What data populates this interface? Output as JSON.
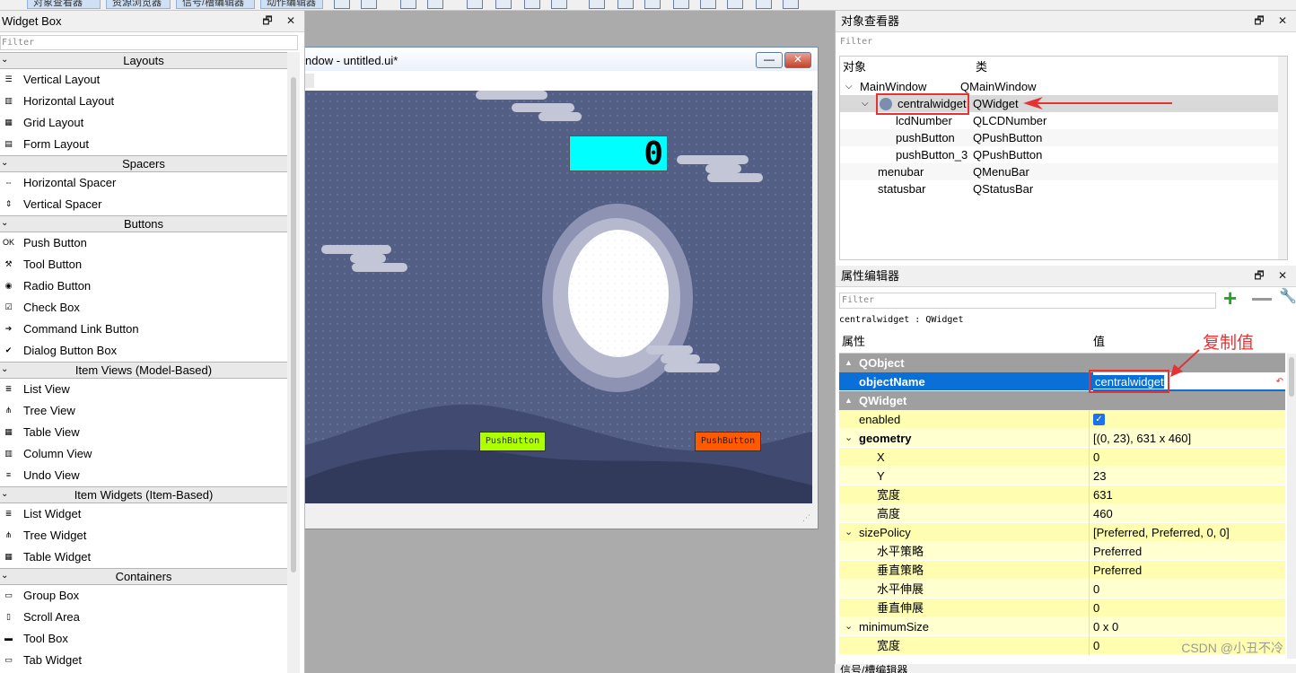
{
  "toolbar": {
    "tabs": [
      "对象查看器",
      "资源浏览器",
      "信号/槽编辑器",
      "动作编辑器"
    ]
  },
  "widget_box": {
    "title": "Widget Box",
    "float_btn": "🗗",
    "close_btn": "✕",
    "filter_placeholder": "Filter",
    "categories": [
      {
        "name": "Layouts",
        "items": [
          "Vertical Layout",
          "Horizontal Layout",
          "Grid Layout",
          "Form Layout"
        ]
      },
      {
        "name": "Spacers",
        "items": [
          "Horizontal Spacer",
          "Vertical Spacer"
        ]
      },
      {
        "name": "Buttons",
        "items": [
          "Push Button",
          "Tool Button",
          "Radio Button",
          "Check Box",
          "Command Link Button",
          "Dialog Button Box"
        ]
      },
      {
        "name": "Item Views (Model-Based)",
        "items": [
          "List View",
          "Tree View",
          "Table View",
          "Column View",
          "Undo View"
        ]
      },
      {
        "name": "Item Widgets (Item-Based)",
        "items": [
          "List Widget",
          "Tree Widget",
          "Table Widget"
        ]
      },
      {
        "name": "Containers",
        "items": [
          "Group Box",
          "Scroll Area",
          "Tool Box",
          "Tab Widget"
        ]
      }
    ]
  },
  "form_window": {
    "title": "ndow - untitled.ui*",
    "minimize": "—",
    "close": "✕",
    "lcd_value": "0",
    "push_button_1": "PushButton",
    "push_button_2": "PushButton"
  },
  "object_inspector": {
    "title": "对象查看器",
    "filter_placeholder": "Filter",
    "col_object": "对象",
    "col_class": "类",
    "rows": [
      {
        "object": "MainWindow",
        "class": "QMainWindow"
      },
      {
        "object": "centralwidget",
        "class": "QWidget"
      },
      {
        "object": "lcdNumber",
        "class": "QLCDNumber"
      },
      {
        "object": "pushButton",
        "class": "QPushButton"
      },
      {
        "object": "pushButton_3",
        "class": "QPushButton"
      },
      {
        "object": "menubar",
        "class": "QMenuBar"
      },
      {
        "object": "statusbar",
        "class": "QStatusBar"
      }
    ]
  },
  "property_editor": {
    "title": "属性编辑器",
    "filter_placeholder": "Filter",
    "caption": "centralwidget : QWidget",
    "col_property": "属性",
    "col_value": "值",
    "rows": [
      {
        "type": "group",
        "key": "QObject"
      },
      {
        "type": "prop",
        "key": "objectName",
        "value": "centralwidget",
        "selected": true
      },
      {
        "type": "group",
        "key": "QWidget"
      },
      {
        "type": "prop",
        "key": "enabled",
        "value": "✓"
      },
      {
        "type": "prop",
        "key": "geometry",
        "value": "[(0, 23), 631 x 460]",
        "bold": true
      },
      {
        "type": "sub",
        "key": "X",
        "value": "0"
      },
      {
        "type": "sub",
        "key": "Y",
        "value": "23"
      },
      {
        "type": "sub",
        "key": "宽度",
        "value": "631"
      },
      {
        "type": "sub",
        "key": "高度",
        "value": "460"
      },
      {
        "type": "prop",
        "key": "sizePolicy",
        "value": "[Preferred, Preferred, 0, 0]"
      },
      {
        "type": "sub",
        "key": "水平策略",
        "value": "Preferred"
      },
      {
        "type": "sub",
        "key": "垂直策略",
        "value": "Preferred"
      },
      {
        "type": "sub",
        "key": "水平伸展",
        "value": "0"
      },
      {
        "type": "sub",
        "key": "垂直伸展",
        "value": "0"
      },
      {
        "type": "prop",
        "key": "minimumSize",
        "value": "0 x 0"
      },
      {
        "type": "sub",
        "key": "宽度",
        "value": "0"
      }
    ]
  },
  "annotation": {
    "copy_label": "复制值"
  },
  "bottom_dock_title": "信号/槽编辑器",
  "watermark": "CSDN @小丑不冷",
  "colors": {
    "accent": "#e53333",
    "lcd": "#00ffff",
    "button_green": "#aeff00",
    "button_orange": "#ff5a00",
    "selection": "#0a6fd6"
  }
}
